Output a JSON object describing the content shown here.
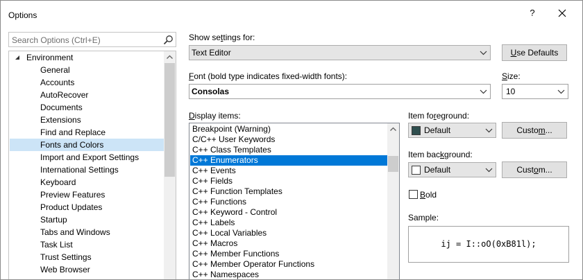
{
  "window": {
    "title": "Options",
    "help_label": "?"
  },
  "search": {
    "placeholder": "Search Options (Ctrl+E)"
  },
  "tree": {
    "root": "Environment",
    "items": [
      "General",
      "Accounts",
      "AutoRecover",
      "Documents",
      "Extensions",
      "Find and Replace",
      "Fonts and Colors",
      "Import and Export Settings",
      "International Settings",
      "Keyboard",
      "Preview Features",
      "Product Updates",
      "Startup",
      "Tabs and Windows",
      "Task List",
      "Trust Settings",
      "Web Browser"
    ],
    "selected": "Fonts and Colors"
  },
  "settings": {
    "show_settings_label_pre": "Show se",
    "show_settings_label_u": "t",
    "show_settings_label_post": "tings for:",
    "show_settings_value": "Text Editor",
    "use_defaults_u": "U",
    "use_defaults_rest": "se Defaults",
    "font_label_u": "F",
    "font_label_rest": "ont (bold type indicates fixed-width fonts):",
    "font_value": "Consolas",
    "size_label_u": "S",
    "size_label_rest": "ize:",
    "size_value": "10"
  },
  "display_items": {
    "label_u": "D",
    "label_rest": "isplay items:",
    "items": [
      "Breakpoint (Warning)",
      "C/C++ User Keywords",
      "C++ Class Templates",
      "C++ Enumerators",
      "C++ Events",
      "C++ Fields",
      "C++ Function Templates",
      "C++ Functions",
      "C++ Keyword - Control",
      "C++ Labels",
      "C++ Local Variables",
      "C++ Macros",
      "C++ Member Functions",
      "C++ Member Operator Functions",
      "C++ Namespaces"
    ],
    "selected": "C++ Enumerators"
  },
  "foreground": {
    "label_pre": "Item fo",
    "label_u": "r",
    "label_post": "eground:",
    "value": "Default",
    "swatch_color": "#2f4f4f",
    "custom_pre": "Custo",
    "custom_u": "m",
    "custom_post": "..."
  },
  "background": {
    "label_pre": "Item bac",
    "label_u": "k",
    "label_post": "ground:",
    "value": "Default",
    "swatch_color": "#ffffff",
    "custom_pre": "Cust",
    "custom_u": "o",
    "custom_post": "m..."
  },
  "bold": {
    "label_u": "B",
    "label_rest": "old",
    "checked": false
  },
  "sample": {
    "label": "Sample:",
    "text": "ij = I::oO(0xB81l);"
  },
  "colors": {
    "selection_list": "#0078d7",
    "selection_tree": "#cce4f7"
  }
}
